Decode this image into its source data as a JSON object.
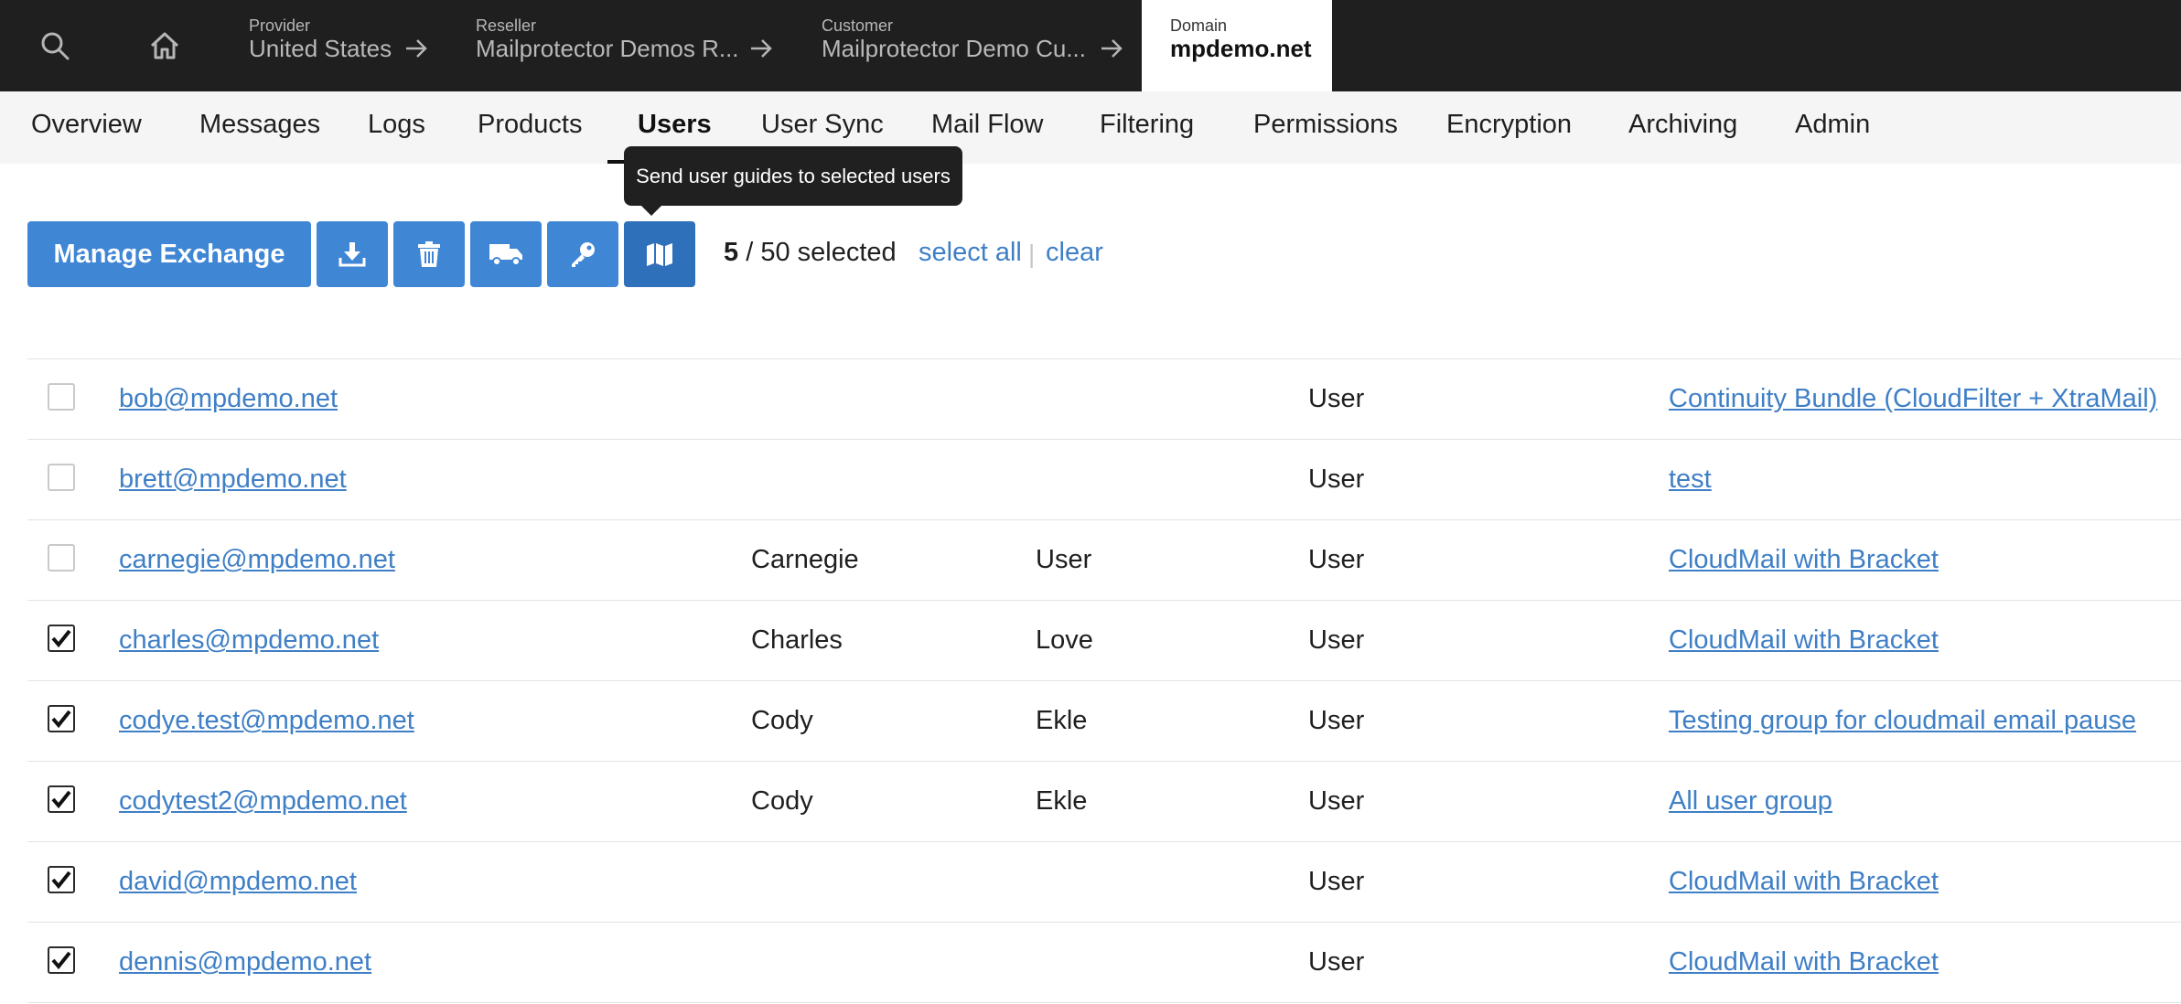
{
  "topbar": {
    "crumbs": [
      {
        "label": "Provider",
        "value": "United States"
      },
      {
        "label": "Reseller",
        "value": "Mailprotector Demos R..."
      },
      {
        "label": "Customer",
        "value": "Mailprotector Demo Cu..."
      }
    ],
    "active": {
      "label": "Domain",
      "value": "mpdemo.net"
    }
  },
  "tabs": [
    "Overview",
    "Messages",
    "Logs",
    "Products",
    "Users",
    "User Sync",
    "Mail Flow",
    "Filtering",
    "Permissions",
    "Encryption",
    "Archiving",
    "Admin"
  ],
  "active_tab": "Users",
  "tooltip": "Send user guides to selected users",
  "toolbar": {
    "manage_label": "Manage Exchange",
    "icons": [
      "download-icon",
      "trash-icon",
      "truck-icon",
      "key-icon",
      "map-icon"
    ],
    "selected_count": "5",
    "selected_total": "/ 50 selected",
    "select_all": "select all",
    "separator": "|",
    "clear": "clear"
  },
  "colors": {
    "accent": "#3f86d4",
    "link": "#3f7fc6",
    "topbar": "#1f1f1f"
  },
  "rows": [
    {
      "email": "bob@mpdemo.net",
      "first": "",
      "last": "",
      "role": "User",
      "group": "Continuity Bundle (CloudFilter + XtraMail)",
      "checked": false
    },
    {
      "email": "brett@mpdemo.net",
      "first": "",
      "last": "",
      "role": "User",
      "group": "test",
      "checked": false
    },
    {
      "email": "carnegie@mpdemo.net",
      "first": "Carnegie",
      "last": "User",
      "role": "User",
      "group": "CloudMail with Bracket",
      "checked": false
    },
    {
      "email": "charles@mpdemo.net",
      "first": "Charles",
      "last": "Love",
      "role": "User",
      "group": "CloudMail with Bracket",
      "checked": true
    },
    {
      "email": "codye.test@mpdemo.net",
      "first": "Cody",
      "last": "Ekle",
      "role": "User",
      "group": "Testing group for cloudmail email pause",
      "checked": true
    },
    {
      "email": "codytest2@mpdemo.net",
      "first": "Cody",
      "last": "Ekle",
      "role": "User",
      "group": "All user group",
      "checked": true
    },
    {
      "email": "david@mpdemo.net",
      "first": "",
      "last": "",
      "role": "User",
      "group": "CloudMail with Bracket",
      "checked": true
    },
    {
      "email": "dennis@mpdemo.net",
      "first": "",
      "last": "",
      "role": "User",
      "group": "CloudMail with Bracket",
      "checked": true
    }
  ]
}
